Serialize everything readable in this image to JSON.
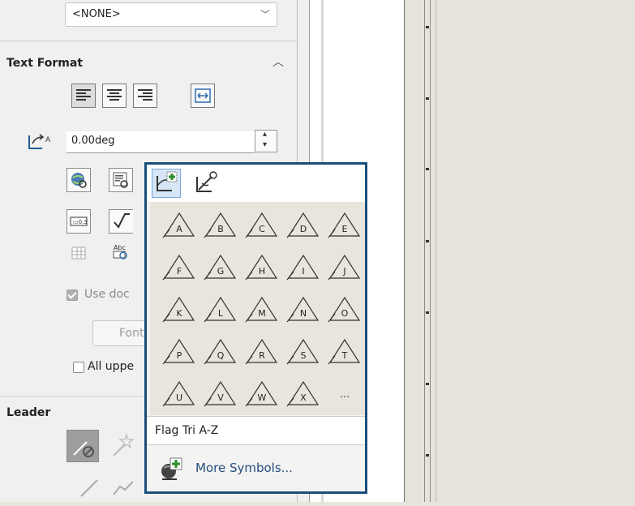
{
  "combo": {
    "value": "<NONE>",
    "icon": "chevron-down-icon"
  },
  "text_format": {
    "title": "Text Format",
    "angle_value": "0.00deg",
    "use_document_font_label": "Use doc",
    "font_button_label": "Font.",
    "all_uppercase_label": "All uppe"
  },
  "leader": {
    "title": "Leader"
  },
  "symbol_popup": {
    "top_icons": [
      "add-symbol-icon",
      "edit-symbol-icon"
    ],
    "symbols": [
      "A",
      "B",
      "C",
      "D",
      "E",
      "F",
      "G",
      "H",
      "I",
      "J",
      "K",
      "L",
      "M",
      "N",
      "O",
      "P",
      "Q",
      "R",
      "S",
      "T",
      "U",
      "V",
      "W",
      "X"
    ],
    "ellipsis": "...",
    "library_name": "Flag Tri A-Z",
    "more_symbols_label": "More Symbols..."
  },
  "colors": {
    "popup_border": "#1b4e7a",
    "link_text": "#264e7b",
    "canvas": "#e6e4da"
  }
}
